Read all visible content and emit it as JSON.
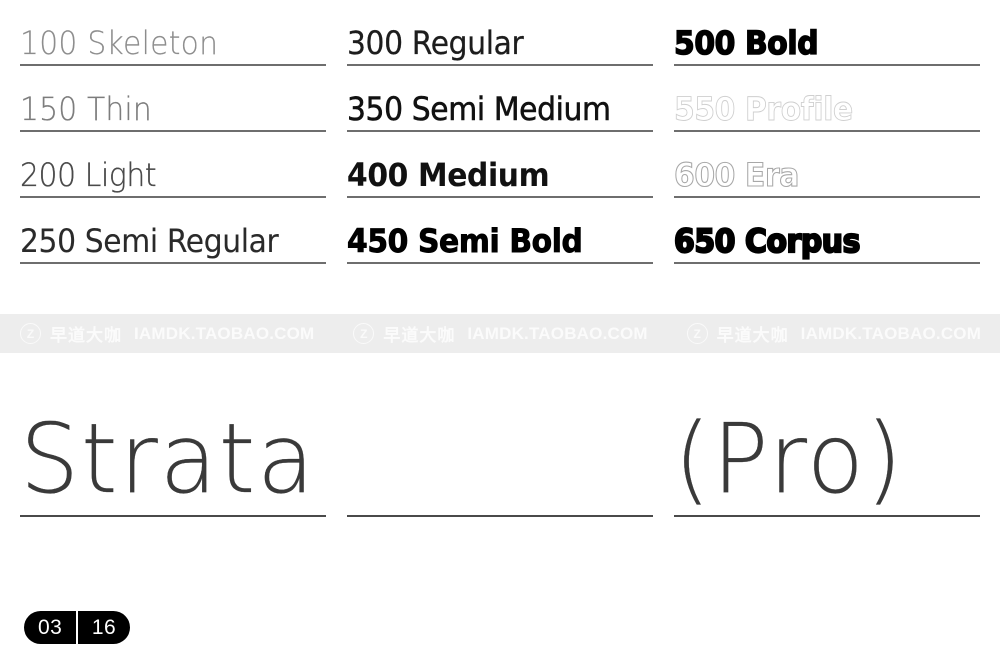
{
  "specimen": {
    "family_name": "Strata",
    "family_suffix": "(Pro)"
  },
  "weights": {
    "columns": [
      {
        "rows": [
          {
            "label": "100 Skeleton",
            "style": "skeleton"
          },
          {
            "label": "150 Thin",
            "style": "thin"
          },
          {
            "label": "200 Light",
            "style": "light"
          },
          {
            "label": "250 Semi Regular",
            "style": "semireg"
          }
        ]
      },
      {
        "rows": [
          {
            "label": "300 Regular",
            "style": "regular"
          },
          {
            "label": "350 Semi Medium",
            "style": "semimed"
          },
          {
            "label": "400 Medium",
            "style": "medium"
          },
          {
            "label": "450 Semi Bold",
            "style": "semibold"
          }
        ]
      },
      {
        "rows": [
          {
            "label": "500 Bold",
            "style": "bold"
          },
          {
            "label": "550 Profile",
            "style": "profile"
          },
          {
            "label": "600 Era",
            "style": "era"
          },
          {
            "label": "650 Corpus",
            "style": "corpus"
          }
        ]
      }
    ]
  },
  "display": {
    "cells": [
      "Strata",
      "",
      "(Pro)"
    ]
  },
  "watermark": {
    "logo_letter": "Z",
    "brand_cn": "早道大咖",
    "url": "IAMDK.TAOBAO.COM",
    "repeat_count": 3,
    "band_color": "#ededed",
    "text_color": "#fbfbfb"
  },
  "page_badge": {
    "current": "03",
    "total": "16",
    "background": "#000000",
    "text_color": "#ffffff"
  }
}
